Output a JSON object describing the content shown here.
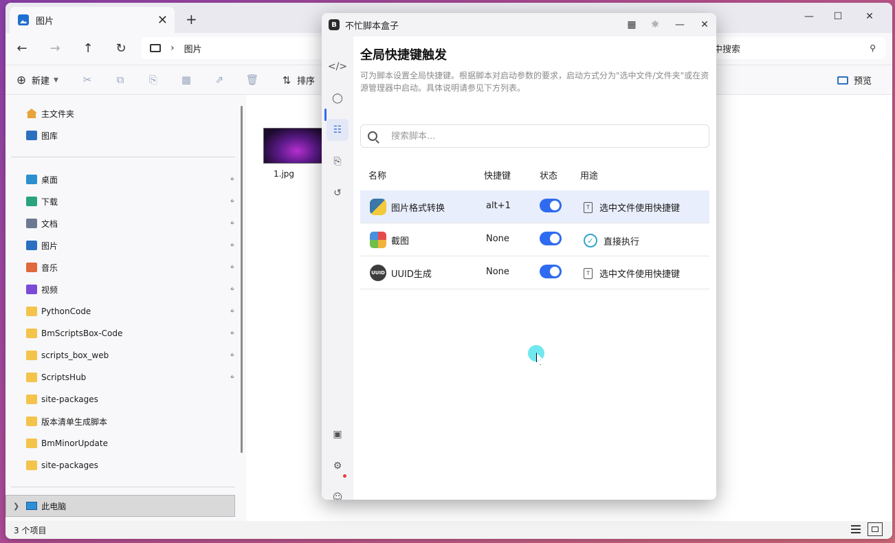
{
  "explorer": {
    "tab_title": "图片",
    "tab_close": "✕",
    "new_tab": "+",
    "window_controls": {
      "minimize": "—",
      "maximize": "☐",
      "close": "✕"
    },
    "nav": {
      "back": "←",
      "forward": "→",
      "up": "↑",
      "refresh": "↻"
    },
    "address": {
      "separator": "›",
      "crumb": "图片"
    },
    "search_text": "中搜索",
    "toolbar": {
      "new_label": "新建",
      "sort_label": "排序",
      "preview_label": "预览"
    },
    "sidebar": {
      "home": "主文件夹",
      "gallery": "图库",
      "quick": [
        {
          "label": "桌面",
          "icon": "desktop-icon",
          "color": "#2b8fcf"
        },
        {
          "label": "下载",
          "icon": "download-icon",
          "color": "#2aa37f"
        },
        {
          "label": "文档",
          "icon": "document-icon",
          "color": "#6c7a91"
        },
        {
          "label": "图片",
          "icon": "pictures-icon",
          "color": "#2b6fc0"
        },
        {
          "label": "音乐",
          "icon": "music-icon",
          "color": "#e0693e"
        },
        {
          "label": "视频",
          "icon": "video-icon",
          "color": "#7b4bd6"
        },
        {
          "label": "PythonCode",
          "icon": "folder-icon",
          "color": "#f3c34b"
        },
        {
          "label": "BmScriptsBox-Code",
          "icon": "folder-icon",
          "color": "#f3c34b"
        },
        {
          "label": "scripts_box_web",
          "icon": "folder-icon",
          "color": "#f3c34b"
        },
        {
          "label": "ScriptsHub",
          "icon": "folder-icon",
          "color": "#f3c34b"
        },
        {
          "label": "site-packages",
          "icon": "folder-icon",
          "color": "#f3c34b"
        },
        {
          "label": "版本清单生成脚本",
          "icon": "folder-icon",
          "color": "#f3c34b"
        },
        {
          "label": "BmMinorUpdate",
          "icon": "folder-icon",
          "color": "#f3c34b"
        },
        {
          "label": "site-packages",
          "icon": "folder-icon",
          "color": "#f3c34b"
        }
      ],
      "this_pc": "此电脑"
    },
    "file": {
      "name": "1.jpg"
    },
    "status": {
      "count": "3 个项目"
    }
  },
  "app": {
    "title": "不忙脚本盒子",
    "logo_letter": "B",
    "heading": "全局快捷键触发",
    "description": "可为脚本设置全局快捷键。根据脚本对启动参数的要求，启动方式分为\"选中文件/文件夹\"或在资源管理器中启动。具体说明请参见下方列表。",
    "search_placeholder": "搜索脚本...",
    "columns": {
      "name": "名称",
      "hotkey": "快捷键",
      "status": "状态",
      "usage": "用途"
    },
    "scripts": [
      {
        "name": "图片格式转换",
        "hotkey": "alt+1",
        "enabled": true,
        "usage": "选中文件使用快捷键",
        "icon": "python-icon"
      },
      {
        "name": "截图",
        "hotkey": "None",
        "enabled": true,
        "usage": "直接执行",
        "icon": "screenshot-icon"
      },
      {
        "name": "UUID生成",
        "hotkey": "None",
        "enabled": true,
        "usage": "选中文件使用快捷键",
        "icon": "uuid-icon"
      }
    ],
    "uuid_icon_text": "UUID",
    "accent": "#2f6bf0"
  }
}
